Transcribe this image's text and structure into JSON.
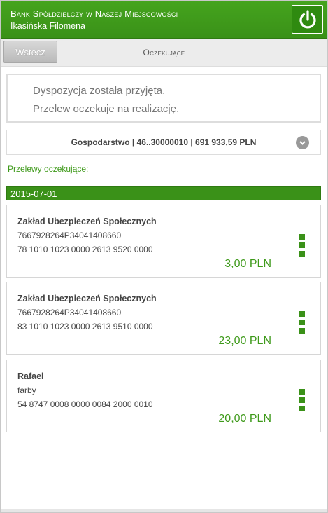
{
  "header": {
    "bank_name": "Bank Spółdzielczy w Naszej Miejscowości",
    "user_name": "Ikasińska Filomena"
  },
  "toolbar": {
    "back_label": "Wstecz",
    "title": "Oczekujące"
  },
  "info": {
    "line1": "Dyspozycja została przyjęta.",
    "line2": "Przelew oczekuje na realizację."
  },
  "account": {
    "label": "Gospodarstwo | 46..30000010 | 691 933,59 PLN"
  },
  "pending": {
    "label": "Przelewy oczekujące:",
    "date": "2015-07-01",
    "items": [
      {
        "name": "Zakład Ubezpieczeń Społecznych",
        "desc": "7667928264P34041408660",
        "account": "78 1010 1023 0000 2613 9520 0000",
        "amount": "3,00 PLN"
      },
      {
        "name": "Zakład Ubezpieczeń Społecznych",
        "desc": "7667928264P34041408660",
        "account": "83 1010 1023 0000 2613 9510 0000",
        "amount": "23,00 PLN"
      },
      {
        "name": "Rafael",
        "desc": "farby",
        "account": "54 8747 0008 0000 0084 2000 0010",
        "amount": "20,00 PLN"
      }
    ]
  },
  "colors": {
    "brand_green": "#3f9a1b",
    "toolbar_bg": "#ececec"
  },
  "icons": {
    "logout": "power-icon",
    "account_toggle": "chevron-down-icon",
    "item_menu": "more-vertical-icon"
  }
}
